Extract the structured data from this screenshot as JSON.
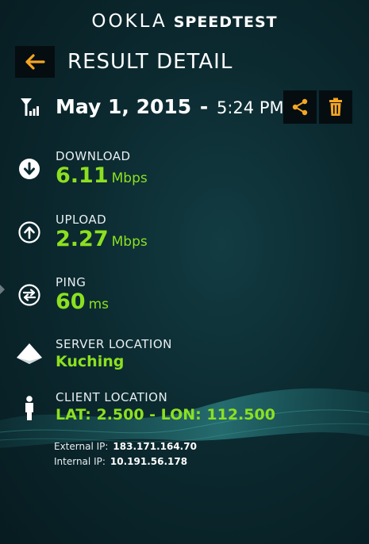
{
  "brand": {
    "ookla": "OOKLA",
    "speedtest": "SPEEDTEST"
  },
  "header": {
    "title": "RESULT DETAIL"
  },
  "result": {
    "date": "May 1, 2015",
    "separator": "-",
    "time": "5:24 PM"
  },
  "download": {
    "label": "DOWNLOAD",
    "value": "6.11",
    "unit": "Mbps"
  },
  "upload": {
    "label": "UPLOAD",
    "value": "2.27",
    "unit": "Mbps"
  },
  "ping": {
    "label": "PING",
    "value": "60",
    "unit": "ms"
  },
  "server": {
    "label": "SERVER LOCATION",
    "value": "Kuching"
  },
  "client": {
    "label": "CLIENT LOCATION",
    "value": "LAT: 2.500 - LON: 112.500"
  },
  "external_ip": {
    "label": "External IP:",
    "value": "183.171.164.70"
  },
  "internal_ip": {
    "label": "Internal IP:",
    "value": "10.191.56.178"
  },
  "colors": {
    "accent": "#f5a623",
    "value_green": "#8ce020",
    "button_bg": "#050d10",
    "background": "#0b2a30"
  },
  "icons": {
    "back": "arrow-left-icon",
    "signal": "signal-icon",
    "share": "share-icon",
    "trash": "trash-icon",
    "download": "download-icon",
    "upload": "upload-icon",
    "ping": "ping-icon",
    "server": "server-location-icon",
    "client": "person-icon"
  }
}
